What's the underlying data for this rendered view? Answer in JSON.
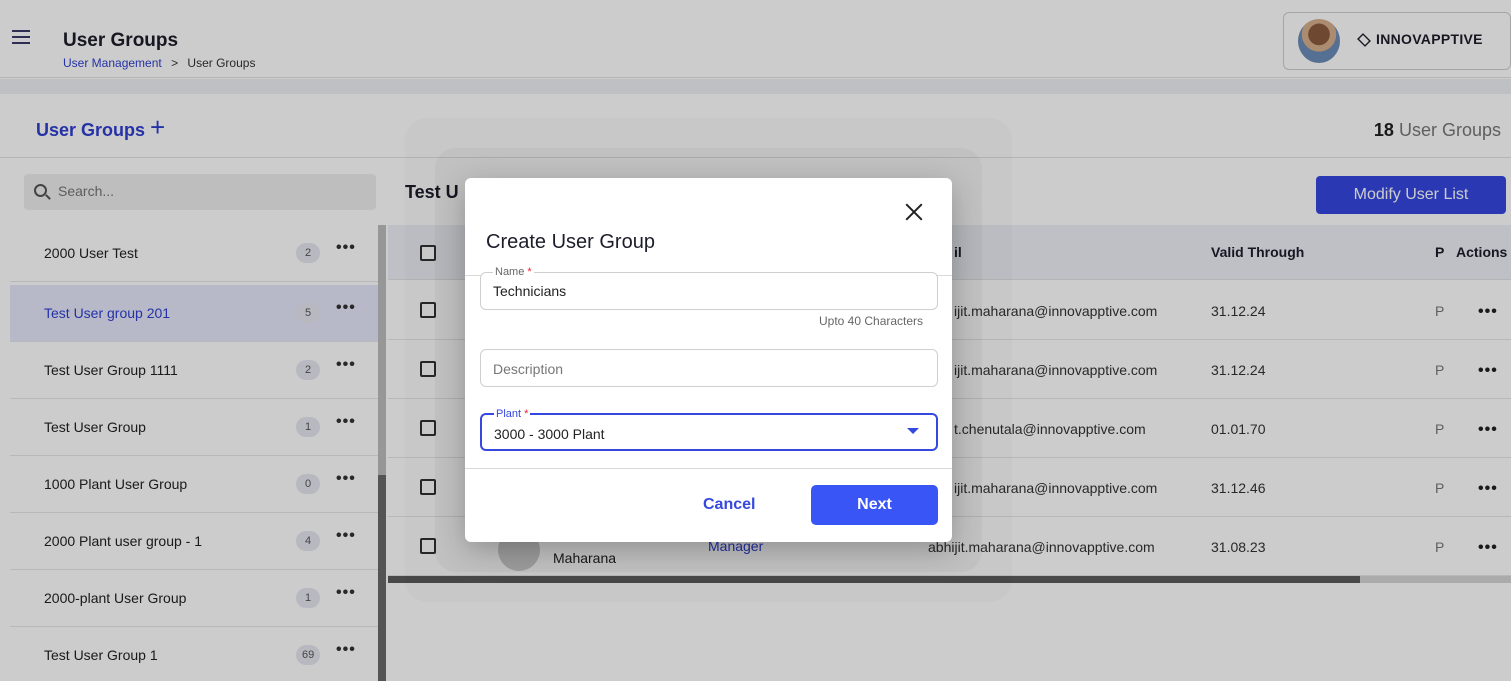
{
  "header": {
    "title": "User Groups",
    "breadcrumb": {
      "link": "User Management",
      "separator": ">",
      "current": "User Groups"
    },
    "brand": "INNOVAPPTIVE"
  },
  "section": {
    "title": "User Groups",
    "add_icon": "plus-icon",
    "count_number": "18",
    "count_label": "User Groups"
  },
  "sidebar": {
    "search_placeholder": "Search...",
    "groups": [
      {
        "name": "2000 User Test",
        "count": "2"
      },
      {
        "name": "Test User group 201",
        "count": "5",
        "selected": true
      },
      {
        "name": "Test User Group 1111",
        "count": "2"
      },
      {
        "name": "Test User Group",
        "count": "1"
      },
      {
        "name": "1000 Plant User Group",
        "count": "0"
      },
      {
        "name": "2000 Plant user group - 1",
        "count": "4"
      },
      {
        "name": "2000-plant User Group",
        "count": "1"
      },
      {
        "name": "Test User Group 1",
        "count": "69"
      }
    ],
    "more_label": "•••"
  },
  "detail": {
    "title": "Test U",
    "modify_button": "Modify User List",
    "columns": {
      "email": "il",
      "valid_through": "Valid Through",
      "p": "P",
      "actions": "Actions"
    },
    "rows": [
      {
        "email": "ijit.maharana@innovapptive.com",
        "valid": "31.12.24",
        "p": "P"
      },
      {
        "email": "ijit.maharana@innovapptive.com",
        "valid": "31.12.24",
        "p": "P"
      },
      {
        "email": "t.chenutala@innovapptive.com",
        "valid": "01.01.70",
        "p": "P"
      },
      {
        "email": "ijit.maharana@innovapptive.com",
        "valid": "31.12.46",
        "p": "P"
      },
      {
        "email": "abhijit.maharana@innovapptive.com",
        "valid": "31.08.23",
        "p": "P",
        "name": "Maharana",
        "role": "Manager"
      }
    ],
    "more_label": "•••"
  },
  "modal": {
    "title": "Create User Group",
    "close_icon": "close-icon",
    "name_label": "Name",
    "name_value": "Technicians",
    "name_helper": "Upto 40 Characters",
    "description_placeholder": "Description",
    "plant_label": "Plant",
    "plant_value": "3000 - 3000 Plant",
    "required_mark": "*",
    "cancel_label": "Cancel",
    "next_label": "Next"
  },
  "colors": {
    "accent": "#3548e0",
    "selected_row": "#e5e8fb",
    "overlay": "rgba(0,0,0,0.2)"
  }
}
